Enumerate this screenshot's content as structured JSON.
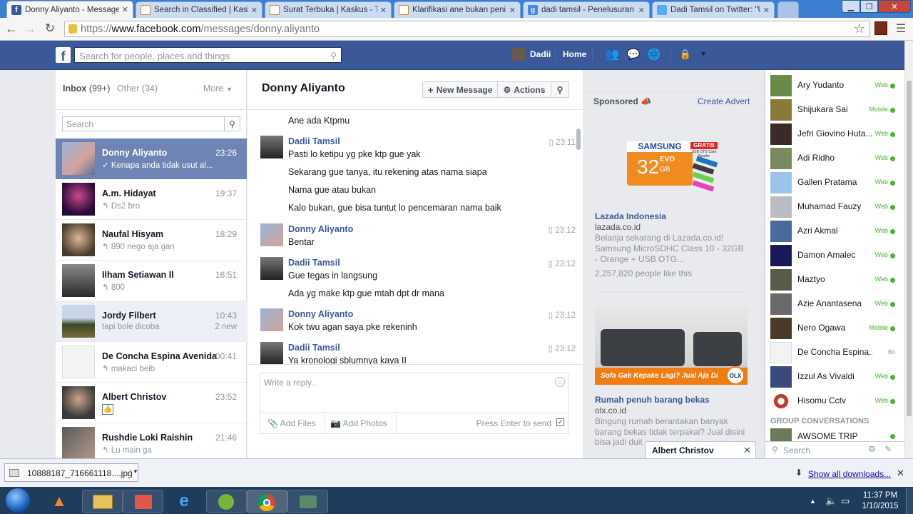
{
  "browser": {
    "tabs": [
      {
        "title": "Donny Aliyanto - Messages",
        "color": "#3b5998",
        "active": true
      },
      {
        "title": "Search in Classified | Kaskus",
        "color": "#e07b2a"
      },
      {
        "title": "Surat Terbuka | Kaskus - T",
        "color": "#e07b2a"
      },
      {
        "title": "Klarifikasi ane bukan peni",
        "color": "#e07b2a"
      },
      {
        "title": "dadi tamsil - Penelusuran",
        "color": "#4a86e8"
      },
      {
        "title": "Dadi Tamsil on Twitter: \"U",
        "color": "#55acee"
      }
    ],
    "url_scheme": "https://",
    "url_host": "www.facebook.com",
    "url_path": "/messages/donny.aliyanto"
  },
  "fb": {
    "search_placeholder": "Search for people, places and things",
    "user": "Dadii",
    "home": "Home"
  },
  "inbox": {
    "label": "Inbox",
    "count": "(99+)",
    "other": "Other",
    "other_count": "(34)",
    "more": "More",
    "search_placeholder": "Search",
    "conversations": [
      {
        "name": "Donny Aliyanto",
        "time": "23:26",
        "snippet": "✓ Kenapa anda tidak usut al...",
        "selected": true
      },
      {
        "name": "A.m. Hidayat",
        "time": "19:37",
        "snippet": "↰ Ds2 bro"
      },
      {
        "name": "Naufal Hisyam",
        "time": "18:29",
        "snippet": "↰ 890 nego aja gan"
      },
      {
        "name": "Ilham Setiawan II",
        "time": "16:51",
        "snippet": "↰ 800"
      },
      {
        "name": "Jordy Filbert",
        "time": "10:43",
        "snippet": "tapi bole dicoba",
        "extra": "2 new",
        "unread": true
      },
      {
        "name": "De Concha Espina Avenida",
        "time": "00:41",
        "snippet": "↰ makaci beib"
      },
      {
        "name": "Albert Christov",
        "time": "23:52",
        "snippet": ""
      },
      {
        "name": "Rushdie Loki Raishin",
        "time": "21:46",
        "snippet": "↰ Lu main ga"
      }
    ]
  },
  "thread": {
    "title": "Donny Aliyanto",
    "new_message": "New Message",
    "actions": "Actions",
    "reply_placeholder": "Write a reply...",
    "add_files": "Add Files",
    "add_photos": "Add Photos",
    "press_enter": "Press Enter to send",
    "messages": [
      {
        "text": "Ane ada Ktpmu"
      },
      {
        "sender": "Dadii Tamsil",
        "time": "23:11",
        "text": "Pasti lo ketipu yg pke ktp gue yak"
      },
      {
        "text": "Sekarang gue tanya, itu rekening atas nama siapa"
      },
      {
        "text": "Nama gue atau bukan"
      },
      {
        "text": "Kalo bukan, gue bisa tuntut lo pencemaran nama baik"
      },
      {
        "sender": "Donny Aliyanto",
        "time": "23:12",
        "text": "Bentar"
      },
      {
        "sender": "Dadii Tamsil",
        "time": "23:12",
        "text": "Gue tegas in langsung"
      },
      {
        "text": "Ada yg make ktp gue mtah dpt dr mana"
      },
      {
        "sender": "Donny Aliyanto",
        "time": "23:12",
        "text": "Kok twu agan saya pke rekeninh"
      },
      {
        "sender": "Dadii Tamsil",
        "time": "23:12",
        "text": "Ya kronologi sblumnya kaya II"
      }
    ]
  },
  "ads": {
    "sponsored": "Sponsored",
    "create_advert": "Create Advert",
    "ad1": {
      "card_brand": "SAMSUNG",
      "card_size": "32",
      "card_unit": "GB",
      "card_series": "EVO",
      "badge": "GRATIS",
      "badge_sub": "USB OTG Card Reader",
      "title": "Lazada Indonesia",
      "domain": "lazada.co.id",
      "body": "Belanja sekarang di Lazada.co.id! Samsung MicroSDHC Class 10 - 32GB - Orange + USB OTG...",
      "likes": "2,257,820 people like this"
    },
    "ad2": {
      "banner": "Sofa Gak Kepake Lagi? Jual Aja Di",
      "logo": "OLX",
      "title": "Rumah penuh barang bekas",
      "domain": "olx.co.id",
      "body": "Bingung rumah berantakan banyak barang bekas tidak terpakai? Jual disini bisa jadi duit"
    }
  },
  "chat": {
    "friends": [
      {
        "name": "Ary Yudanto",
        "status": "Web"
      },
      {
        "name": "Shijukara Sai",
        "status": "Mobile"
      },
      {
        "name": "Jefri Giovino Huta...",
        "status": "Web"
      },
      {
        "name": "Adi Ridho",
        "status": "Web"
      },
      {
        "name": "Gallen Pratama",
        "status": "Web"
      },
      {
        "name": "Muhamad Fauzy",
        "status": "Web"
      },
      {
        "name": "Azri Akmal",
        "status": "Web"
      },
      {
        "name": "Damon Amalec",
        "status": "Web"
      },
      {
        "name": "Maztyo",
        "status": "Web"
      },
      {
        "name": "Azie Anantasena",
        "status": "Web"
      },
      {
        "name": "Nero Ogawa",
        "status": "Mobile"
      },
      {
        "name": "De Concha Espina...",
        "status": "6h"
      },
      {
        "name": "Izzul As Vivaldi",
        "status": "Web"
      },
      {
        "name": "Hisomu Cctv",
        "status": "Web"
      }
    ],
    "group_header": "GROUP CONVERSATIONS",
    "group": "AWSOME TRIP",
    "search": "Search",
    "chat_tab": "Albert Christov"
  },
  "downloads": {
    "file": "10888187_716661118....jpg",
    "show_all": "Show all downloads..."
  },
  "taskbar": {
    "time": "11:37 PM",
    "date": "1/10/2015"
  },
  "colors": {
    "fb_blue": "#3b5998",
    "selected": "#6d84b4",
    "online": "#42b72a"
  }
}
